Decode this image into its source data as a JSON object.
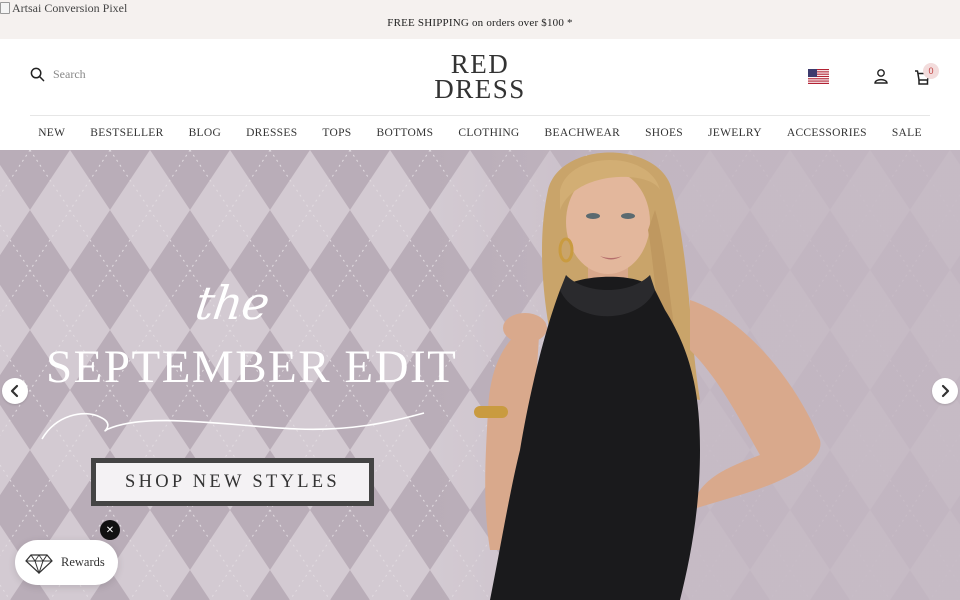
{
  "pixel": {
    "alt": "Artsai Conversion Pixel"
  },
  "announcement": {
    "text": "FREE SHIPPING on orders over $100 *"
  },
  "header": {
    "search_placeholder": "Search",
    "logo_line1": "RED",
    "logo_line2": "DRESS",
    "cart_count": "0",
    "region_flag": "us-flag-icon"
  },
  "nav": {
    "items": [
      "NEW",
      "BESTSELLER",
      "BLOG",
      "DRESSES",
      "TOPS",
      "BOTTOMS",
      "CLOTHING",
      "BEACHWEAR",
      "SHOES",
      "JEWELRY",
      "ACCESSORIES",
      "SALE"
    ]
  },
  "hero": {
    "script_text": "the",
    "headline": "SEPTEMBER EDIT",
    "cta_label": "SHOP NEW STYLES",
    "background_color": "#c7bdc6"
  },
  "rewards": {
    "label": "Rewards",
    "close_label": "✕"
  },
  "colors": {
    "announce_bg": "#f5f1ef",
    "badge_bg": "#f3dcdc",
    "hero_bg": "#c7bdc6"
  }
}
